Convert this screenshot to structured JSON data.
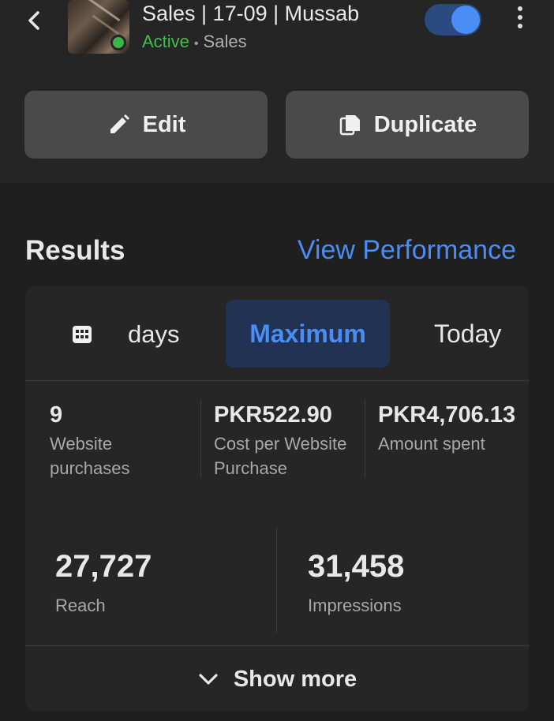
{
  "header": {
    "title": "Sales | 17-09 | Mussab",
    "status": "Active",
    "separator": "•",
    "campaign_type": "Sales",
    "toggle_on": true,
    "edit_label": "Edit",
    "duplicate_label": "Duplicate"
  },
  "results": {
    "title": "Results",
    "view_performance": "View Performance",
    "tabs": {
      "days_label": "days",
      "selected": "Maximum",
      "today": "Today"
    },
    "metrics": [
      {
        "value": "9",
        "label": "Website purchases"
      },
      {
        "value": "PKR522.90",
        "label": "Cost per Website Purchase"
      },
      {
        "value": "PKR4,706.13",
        "label": "Amount spent"
      }
    ],
    "big_metrics": [
      {
        "value": "27,727",
        "label": "Reach"
      },
      {
        "value": "31,458",
        "label": "Impressions"
      }
    ],
    "show_more": "Show more"
  },
  "colors": {
    "accent": "#4a8df5",
    "active_green": "#3fbf4e",
    "background": "#1f1f1f"
  }
}
